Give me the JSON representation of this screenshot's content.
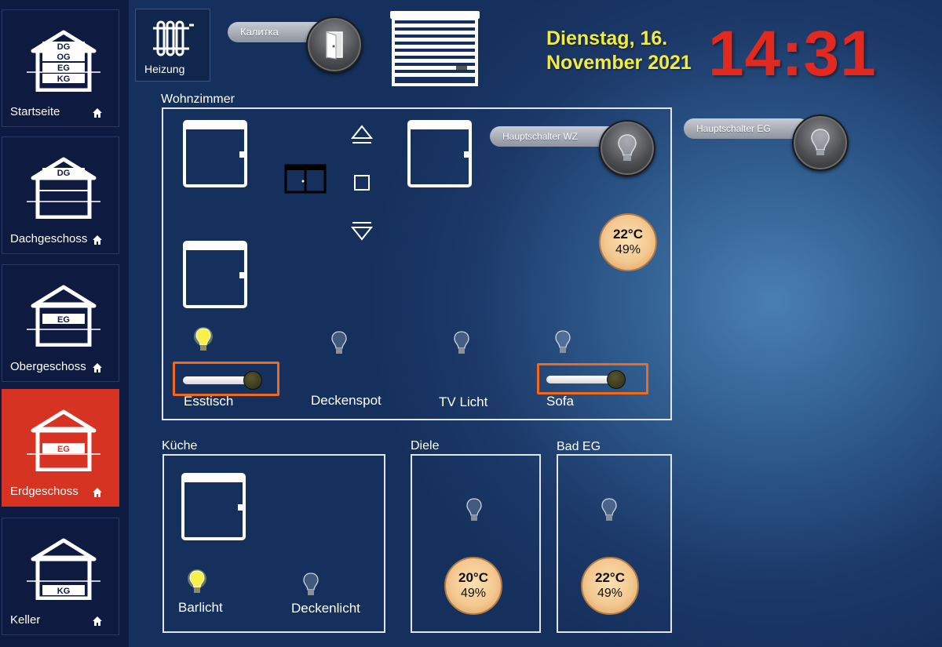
{
  "sidebar": {
    "items": [
      {
        "label": "Startseite",
        "floors": [
          "DG",
          "OG",
          "EG",
          "KG"
        ],
        "active": false
      },
      {
        "label": "Dachgeschoss",
        "floors": [
          "DG"
        ],
        "active": false
      },
      {
        "label": "Obergeschoss",
        "floors": [
          "EG"
        ],
        "active": false
      },
      {
        "label": "Erdgeschoss",
        "floors": [
          "EG"
        ],
        "active": true
      },
      {
        "label": "Keller",
        "floors": [
          "KG"
        ],
        "active": false
      }
    ]
  },
  "header": {
    "heizung_label": "Heizung",
    "gate_label": "Калитка",
    "date_line1": "Dienstag, 16.",
    "date_line2": "November 2021",
    "time": "14:31"
  },
  "master_switches": {
    "wz_label": "Hauptschalter WZ",
    "eg_label": "Hauptschalter EG"
  },
  "rooms": {
    "wohnzimmer": {
      "title": "Wohnzimmer",
      "climate": {
        "temp": "22°C",
        "humidity": "49%"
      },
      "lights": [
        {
          "label": "Esstisch",
          "on": true,
          "dimmer": true
        },
        {
          "label": "Deckenspot",
          "on": false
        },
        {
          "label": "TV Licht",
          "on": false
        },
        {
          "label": "Sofa",
          "on": false,
          "dimmer": true
        }
      ]
    },
    "kueche": {
      "title": "Küche",
      "lights": [
        {
          "label": "Barlicht",
          "on": true
        },
        {
          "label": "Deckenlicht",
          "on": false
        }
      ]
    },
    "diele": {
      "title": "Diele",
      "climate": {
        "temp": "20°C",
        "humidity": "49%"
      }
    },
    "bad": {
      "title": "Bad EG",
      "climate": {
        "temp": "22°C",
        "humidity": "49%"
      }
    }
  },
  "colors": {
    "accent_active": "#d63323",
    "date_yellow": "#f3ec3a",
    "clock_red": "#e02a1f",
    "highlight_orange": "#f06a1a"
  }
}
